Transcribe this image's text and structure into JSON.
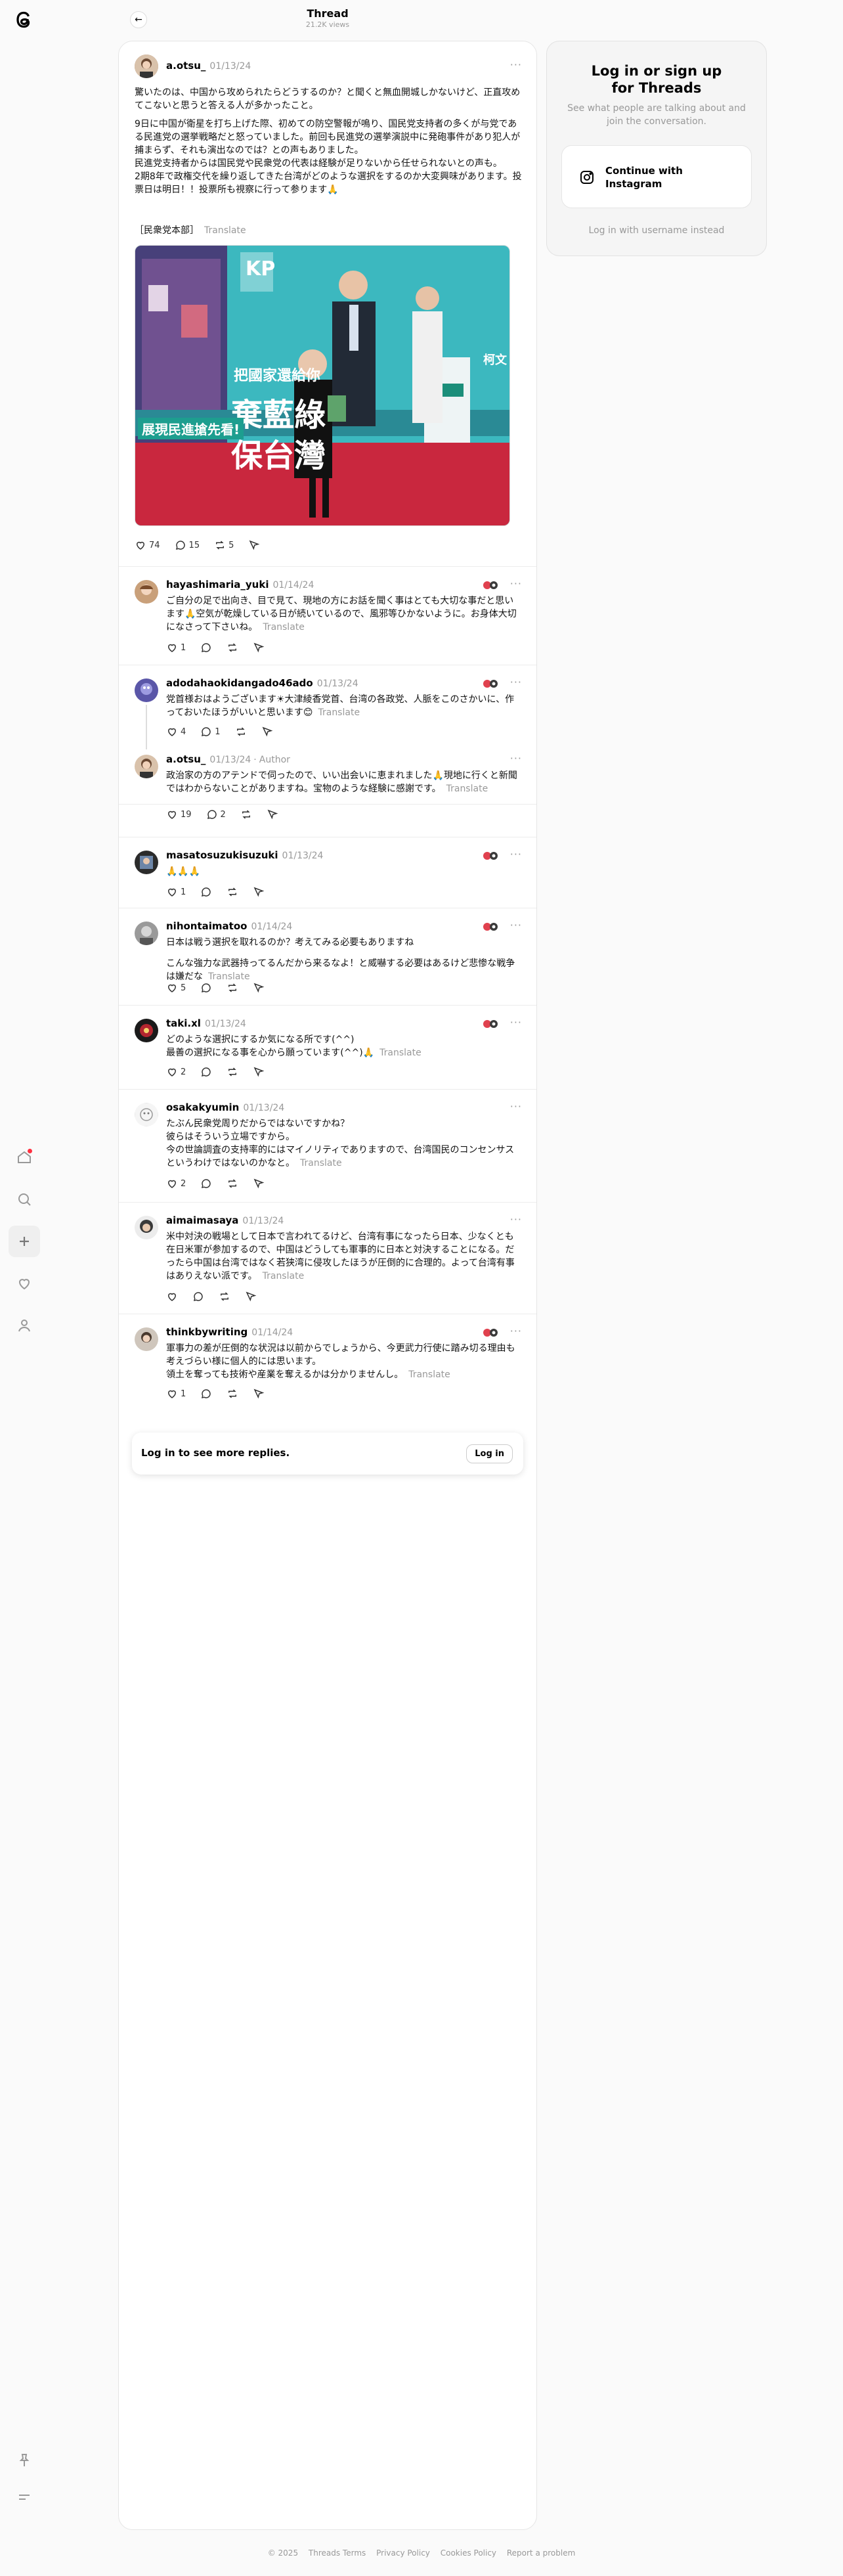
{
  "header": {
    "title": "Thread",
    "views": "21.2K views"
  },
  "main_post": {
    "username": "a.otsu_",
    "date": "01/13/24",
    "paragraphs": [
      "驚いたのは、中国から攻められたらどうするのか？と聞くと無血開城しかないけど、正直攻めてこないと思うと答える人が多かったこと。",
      "9日に中国が衛星を打ち上げた際、初めての防空警報が鳴り、国民党支持者の多くが与党である民進党の選挙戦略だと怒っていました。前回も民進党の選挙演説中に発砲事件があり犯人が捕まらず、それも演出なのでは？との声もありました。",
      "民進党支持者からは国民党や民衆党の代表は経験が足りないから任せられないとの声も。",
      "2期8年で政権交代を繰り返してきた台湾がどのような選択をするのか大変興味があります。投票日は明日！！投票所も視察に行って参ります🙏"
    ],
    "tag": "［民衆党本部］",
    "translate": "Translate",
    "likes": "74",
    "replies": "15",
    "reposts": "5"
  },
  "replies": [
    {
      "username": "hayashimaria_yuki",
      "date": "01/14/24",
      "lines": [
        "ご自分の足で出向き、目で見て、現地の方にお話を聞く事はとても大切な事だと思います🙏空気が乾燥している日が続いているので、風邪等ひかないように。お身体大切になさって下さいね。"
      ],
      "likes": "1",
      "replies": "",
      "reposts": ""
    },
    {
      "username": "adodahaokidangado46ado",
      "date": "01/13/24",
      "lines": [
        "党首様おはようございます☀大津綾香党首、台湾の各政党、人脈をこのさかいに、作っておいたほうがいいと思います😊"
      ],
      "likes": "4",
      "replies": "1",
      "reposts": ""
    },
    {
      "username": "a.otsu_",
      "date": "01/13/24",
      "author": "Author",
      "lines": [
        "政治家の方のアテンドで伺ったので、いい出会いに恵まれました🙏現地に行くと新聞ではわからないことがありますね。宝物のような経験に感謝です。"
      ],
      "likes": "19",
      "replies": "2",
      "reposts": ""
    },
    {
      "username": "masatosuzukisuzuki",
      "date": "01/13/24",
      "lines": [
        "🙏🙏🙏"
      ],
      "likes": "1",
      "replies": "",
      "reposts": ""
    },
    {
      "username": "nihontaimatoo",
      "date": "01/14/24",
      "lines": [
        "日本は戦う選択を取れるのか？考えてみる必要もありますね",
        "こんな強力な武器持ってるんだから来るなよ！と威嚇する必要はあるけど悲惨な戦争は嫌だな"
      ],
      "likes": "5",
      "replies": "",
      "reposts": ""
    },
    {
      "username": "taki.xl",
      "date": "01/13/24",
      "lines": [
        "どのような選択にするか気になる所です(^^)",
        "最善の選択になる事を心から願っています(^^)🙏"
      ],
      "likes": "2",
      "replies": "",
      "reposts": ""
    },
    {
      "username": "osakakyumin",
      "date": "01/13/24",
      "lines": [
        "たぶん民衆党周りだからではないですかね？",
        "彼らはそういう立場ですから。",
        "今の世論調査の支持率的にはマイノリティでありますので、台湾国民のコンセンサスというわけではないのかなと。"
      ],
      "likes": "2",
      "replies": "",
      "reposts": ""
    },
    {
      "username": "aimaimasaya",
      "date": "01/13/24",
      "lines": [
        "米中対決の戦場として日本で言われてるけど、台湾有事になったら日本、少なくとも在日米軍が参加するので、中国はどうしても軍事的に日本と対決することになる。だったら中国は台湾ではなく若狭湾に侵攻したほうが圧倒的に合理的。よって台湾有事はありえない派です。"
      ],
      "likes": "",
      "replies": "",
      "reposts": ""
    },
    {
      "username": "thinkbywriting",
      "date": "01/14/24",
      "lines": [
        "軍事力の差が圧倒的な状況は以前からでしょうから、今更武力行使に踏み切る理由も考えづらい様に個人的には思います。",
        "領土を奪っても技術や産業を奪えるかは分かりませんし。"
      ],
      "likes": "1",
      "replies": "",
      "reposts": ""
    }
  ],
  "login_more": {
    "text": "Log in to see more replies.",
    "button": "Log in"
  },
  "sidebar_panel": {
    "title_line1": "Log in or sign up",
    "title_line2": "for Threads",
    "subtitle": "See what people are talking about and join the conversation.",
    "instagram_line1": "Continue with",
    "instagram_line2": "Instagram",
    "username_link": "Log in with username instead"
  },
  "photo_sign": {
    "line1": "把國家還給你",
    "line2": "棄藍綠",
    "line3": "保台灣",
    "badge": "KP",
    "ribbon": "展現民進搶先看!",
    "right_text": "柯文"
  },
  "footer": [
    "© 2025",
    "Threads Terms",
    "Privacy Policy",
    "Cookies Policy",
    "Report a problem"
  ]
}
